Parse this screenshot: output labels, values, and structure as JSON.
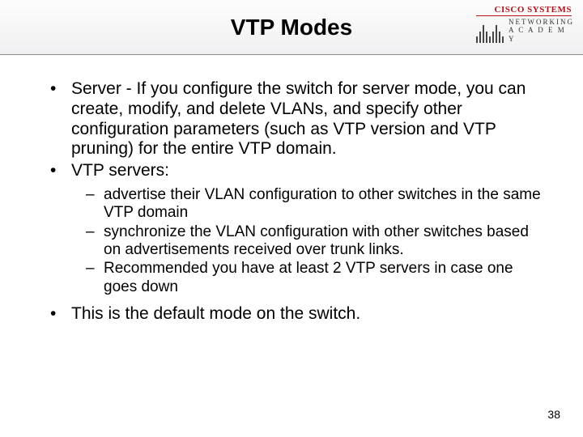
{
  "header": {
    "title": "VTP Modes",
    "logo": {
      "brand": "CISCO SYSTEMS",
      "line1": "NETWORKING",
      "line2": "A C A D E M Y"
    }
  },
  "bullets": {
    "b1": "Server - If you configure the switch for server mode, you can create, modify, and delete VLANs, and specify other configuration parameters (such as VTP version and VTP pruning) for the entire VTP domain.",
    "b2": "VTP servers:",
    "sub1": "advertise their VLAN configuration to other switches in the same VTP domain",
    "sub2": "synchronize the VLAN configuration with other switches based on advertisements received over trunk links.",
    "sub3": "Recommended you have at least 2 VTP servers in case one goes down",
    "b3": "This is the default mode on the switch."
  },
  "page_number": "38"
}
